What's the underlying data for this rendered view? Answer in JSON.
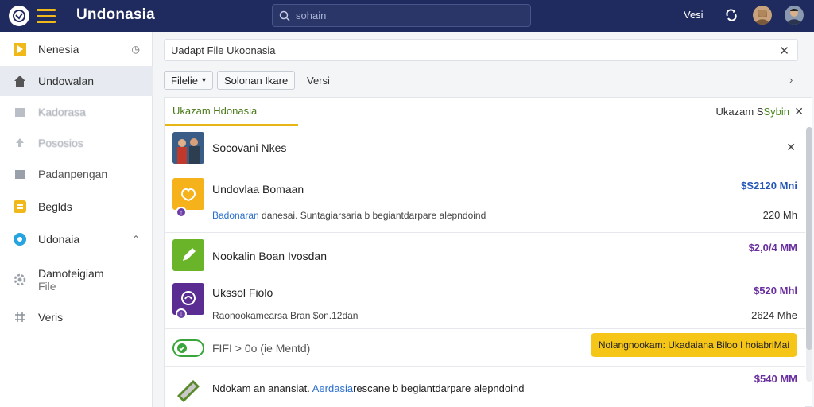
{
  "app": {
    "title": "Undonasia"
  },
  "search": {
    "placeholder": "sohain"
  },
  "topbar": {
    "link": "Vesi"
  },
  "sidebar": {
    "items": [
      {
        "label": "Nenesia",
        "icon": "play-icon",
        "trail": "◷"
      },
      {
        "label": "Undowalan",
        "icon": "home-icon"
      },
      {
        "label": "Kadorasa",
        "icon": "box-icon"
      },
      {
        "label": "Pososios",
        "icon": "upload-icon"
      },
      {
        "label": "Padanpengan",
        "icon": "folder-icon"
      },
      {
        "label": "Beglds",
        "icon": "grid-icon"
      },
      {
        "label": "Udonaia",
        "icon": "chat-icon",
        "trail": "⌃"
      },
      {
        "label": "Damoteigiam",
        "label2": "File",
        "icon": "settings-icon"
      },
      {
        "label": "Veris",
        "icon": "tools-icon"
      }
    ]
  },
  "main": {
    "path": "Uadapt File Ukoonasia",
    "buttons": {
      "filter": "Filelie",
      "filter_caret": "▾",
      "sort": "Solonan Ikare"
    },
    "toolbar_text": "Versi",
    "tabs": {
      "active": "Ukazam Hdonasia",
      "right_prefix": "Ukazam S",
      "right_highlight": "Sybin"
    },
    "rows": [
      {
        "title": "Socovani Nkes"
      },
      {
        "title": "Undovlaa Bomaan",
        "price": "$S2120 Mni",
        "sub_link": "Badonaran",
        "sub": " danesai. Suntagiarsaria b begiantdarpare alepndoind",
        "size": "220 Mh"
      },
      {
        "title": "Nookalin Boan Ivosdan",
        "price": "$2,0/4 MM"
      },
      {
        "title": "Ukssol Fiolo",
        "price": "$520 Mhl",
        "sub": "Raonookamearsa Bran $on.12dan",
        "size": "2624 Mhe"
      },
      {
        "title": "FIFI > 0o (ie Mentd)",
        "button": "Nolangnookam: Ukadaiana Biloo I hoiabriMai"
      },
      {
        "title_pre": "Ndokam an anansiat.",
        "sub_link": "Aerdasia",
        "title_post": "rescane b begiantdarpare alepndoind",
        "price": "$540 MM"
      }
    ],
    "colors": {
      "price_blue": "#2456b8",
      "price_purple": "#6a2f9e",
      "accent": "#f5c518"
    }
  }
}
